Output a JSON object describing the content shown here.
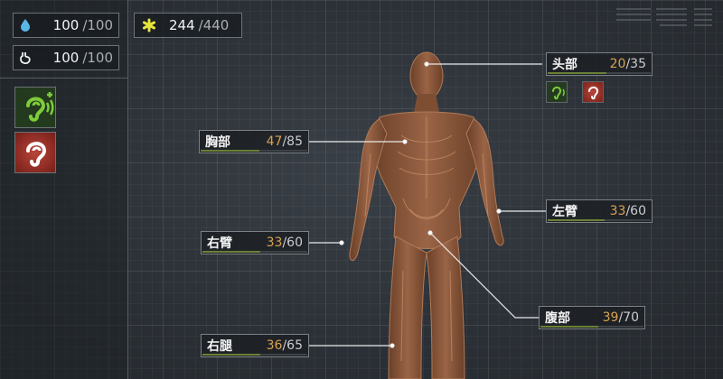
{
  "sidebar": {
    "water": {
      "icon": "water-drop-icon",
      "current": "100",
      "max": "/100"
    },
    "food": {
      "icon": "stomach-icon",
      "current": "100",
      "max": "/100"
    },
    "status_icons": [
      {
        "icon": "ear-hearing-icon",
        "state": "normal",
        "color": "#7dcc3a"
      },
      {
        "icon": "ear-damaged-icon",
        "state": "damaged",
        "color": "#b8453a"
      }
    ]
  },
  "energy": {
    "icon": "energy-star-icon",
    "current": "244",
    "max": "/440"
  },
  "body_parts": {
    "head": {
      "name": "头部",
      "current": "20",
      "max": "/35",
      "fraction": 0.57
    },
    "chest": {
      "name": "胸部",
      "current": "47",
      "max": "/85",
      "fraction": 0.55
    },
    "left_arm": {
      "name": "左臂",
      "current": "33",
      "max": "/60",
      "fraction": 0.55
    },
    "right_arm": {
      "name": "右臂",
      "current": "33",
      "max": "/60",
      "fraction": 0.55
    },
    "stomach": {
      "name": "腹部",
      "current": "39",
      "max": "/70",
      "fraction": 0.56
    },
    "right_leg": {
      "name": "右腿",
      "current": "36",
      "max": "/65",
      "fraction": 0.55
    }
  },
  "head_status_icons": [
    {
      "icon": "ear-hearing-icon",
      "color": "#7dcc3a"
    },
    {
      "icon": "ear-damaged-icon",
      "color": "#b8453a"
    }
  ],
  "colors": {
    "current_value": "#d9a24f",
    "bar_fill": "#6a8036",
    "body": "#8a5a3c"
  }
}
